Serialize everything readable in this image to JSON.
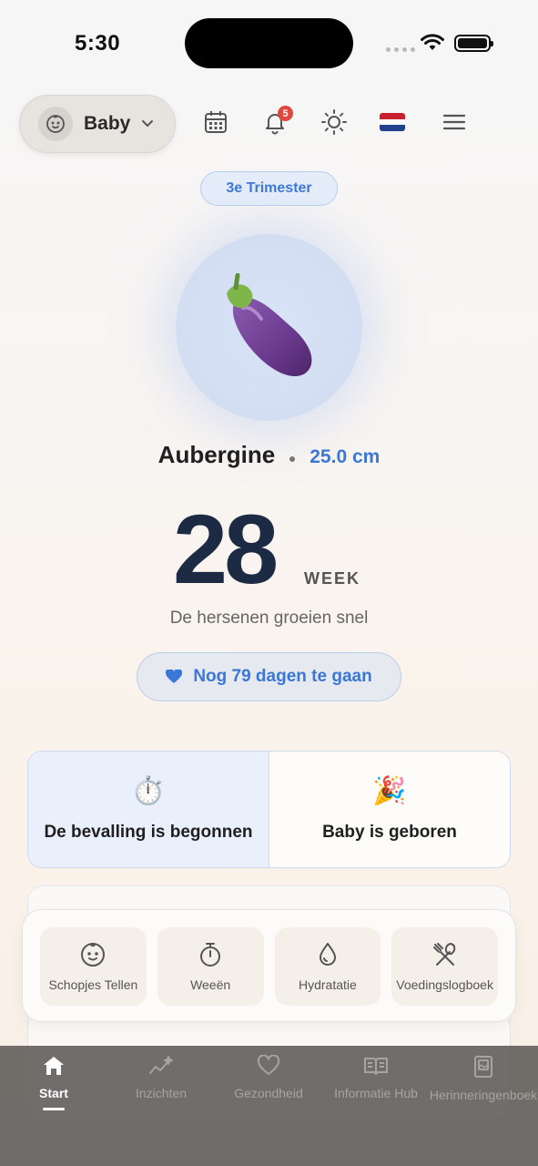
{
  "status_bar": {
    "time": "5:30"
  },
  "header": {
    "profile_label": "Baby",
    "notifications_count": "5"
  },
  "trimester": "3e Trimester",
  "fruit": {
    "emoji": "🍆",
    "name": "Aubergine",
    "size": "25.0 cm"
  },
  "week": {
    "number": "28",
    "label": "WEEK",
    "subtitle": "De hersenen groeien snel"
  },
  "countdown": "Nog 79 dagen te gaan",
  "birth_actions": [
    {
      "emoji": "⏱️",
      "label": "De bevalling is begonnen"
    },
    {
      "emoji": "🎉",
      "label": "Baby is geboren"
    }
  ],
  "tools": [
    {
      "icon": "baby-face-icon",
      "label": "Schopjes Tellen"
    },
    {
      "icon": "stopwatch-icon",
      "label": "Weeën"
    },
    {
      "icon": "droplet-icon",
      "label": "Hydratatie"
    },
    {
      "icon": "utensils-icon",
      "label": "Voedingslogboek"
    }
  ],
  "tabs": [
    {
      "icon": "home-icon",
      "label": "Start",
      "active": true
    },
    {
      "icon": "sparkle-chart-icon",
      "label": "Inzichten"
    },
    {
      "icon": "heart-icon",
      "label": "Gezondheid"
    },
    {
      "icon": "book-icon",
      "label": "Informatie Hub"
    },
    {
      "icon": "photo-book-icon",
      "label": "Herinneringenboek"
    }
  ],
  "colors": {
    "accent": "#3b77d9",
    "badge": "#e0463c",
    "week_number": "#1d2a44"
  }
}
